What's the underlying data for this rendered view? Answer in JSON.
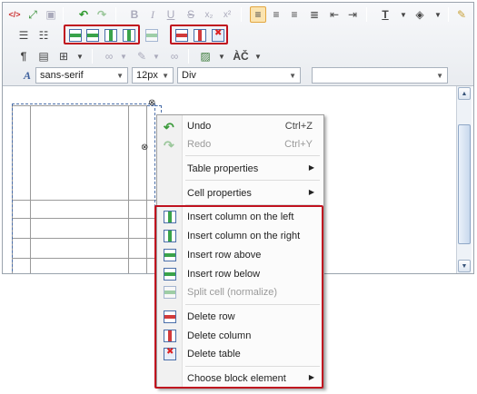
{
  "toolbar": {
    "bold": "B",
    "italic": "I",
    "underline": "U",
    "strike": "S",
    "subscript": "x₂",
    "superscript": "x²",
    "source_icon": "</>",
    "spell_label": "ÀČ",
    "font_family": "sans-serif",
    "font_size": "12px",
    "block_format": "Div",
    "style_value": ""
  },
  "context_menu": {
    "undo": {
      "label": "Undo",
      "shortcut": "Ctrl+Z"
    },
    "redo": {
      "label": "Redo",
      "shortcut": "Ctrl+Y"
    },
    "table_properties": "Table properties",
    "cell_properties": "Cell properties",
    "insert_col_left": "Insert column on the left",
    "insert_col_right": "Insert column on the right",
    "insert_row_above": "Insert row above",
    "insert_row_below": "Insert row below",
    "split_cell": "Split cell (normalize)",
    "delete_row": "Delete row",
    "delete_column": "Delete column",
    "delete_table": "Delete table",
    "choose_block": "Choose block element"
  },
  "colors": {
    "highlight": "#c0121f",
    "accent": "#4a6ea9"
  }
}
